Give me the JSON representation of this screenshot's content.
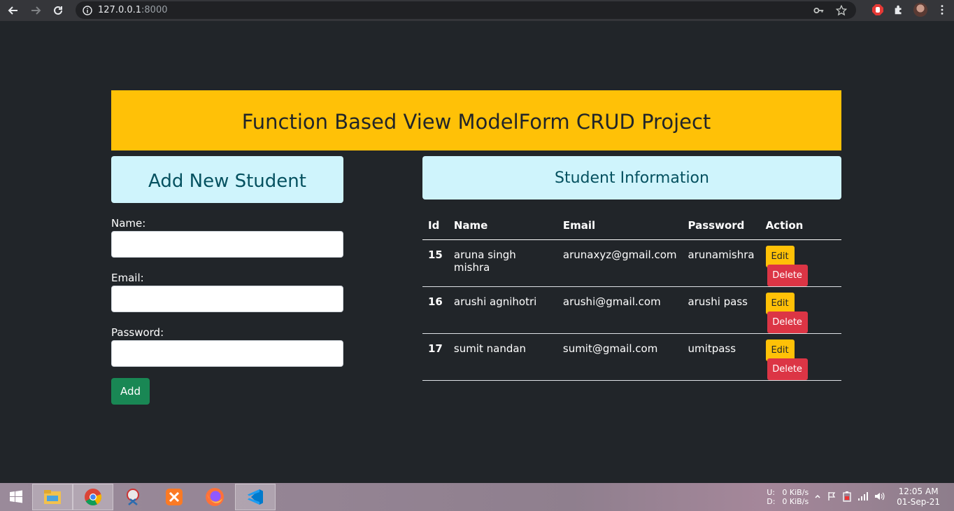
{
  "browser": {
    "url_host": "127.0.0.1",
    "url_port": ":8000"
  },
  "page": {
    "title": "Function Based View ModelForm CRUD Project"
  },
  "form": {
    "heading": "Add New Student",
    "name_label": "Name:",
    "email_label": "Email:",
    "password_label": "Password:",
    "name_value": "",
    "email_value": "",
    "password_value": "",
    "add_label": "Add"
  },
  "table": {
    "heading": "Student Information",
    "columns": [
      "Id",
      "Name",
      "Email",
      "Password",
      "Action"
    ],
    "rows": [
      {
        "id": "15",
        "name": "aruna singh mishra",
        "email": "arunaxyz@gmail.com",
        "password": "arunamishra",
        "edit": "Edit",
        "delete": "Delete"
      },
      {
        "id": "16",
        "name": "arushi agnihotri",
        "email": "arushi@gmail.com",
        "password": "arushi pass",
        "edit": "Edit",
        "delete": "Delete"
      },
      {
        "id": "17",
        "name": "sumit nandan",
        "email": "sumit@gmail.com",
        "password": "umitpass",
        "edit": "Edit",
        "delete": "Delete"
      }
    ]
  },
  "taskbar": {
    "apps": [
      "windows-start-icon",
      "file-explorer-icon",
      "chrome-icon",
      "snipping-tool-icon",
      "xampp-icon",
      "firefox-icon",
      "vscode-icon"
    ],
    "upload_label": "U:",
    "download_label": "D:",
    "upload_speed": "0 KiB/s",
    "download_speed": "0 KiB/s",
    "time": "12:05 AM",
    "date": "01-Sep-21"
  },
  "colors": {
    "page_bg": "#212529",
    "banner": "#ffc107",
    "info_bg": "#cff4fc",
    "info_text": "#055160",
    "success": "#198754",
    "warning": "#ffc107",
    "danger": "#dc3545"
  }
}
